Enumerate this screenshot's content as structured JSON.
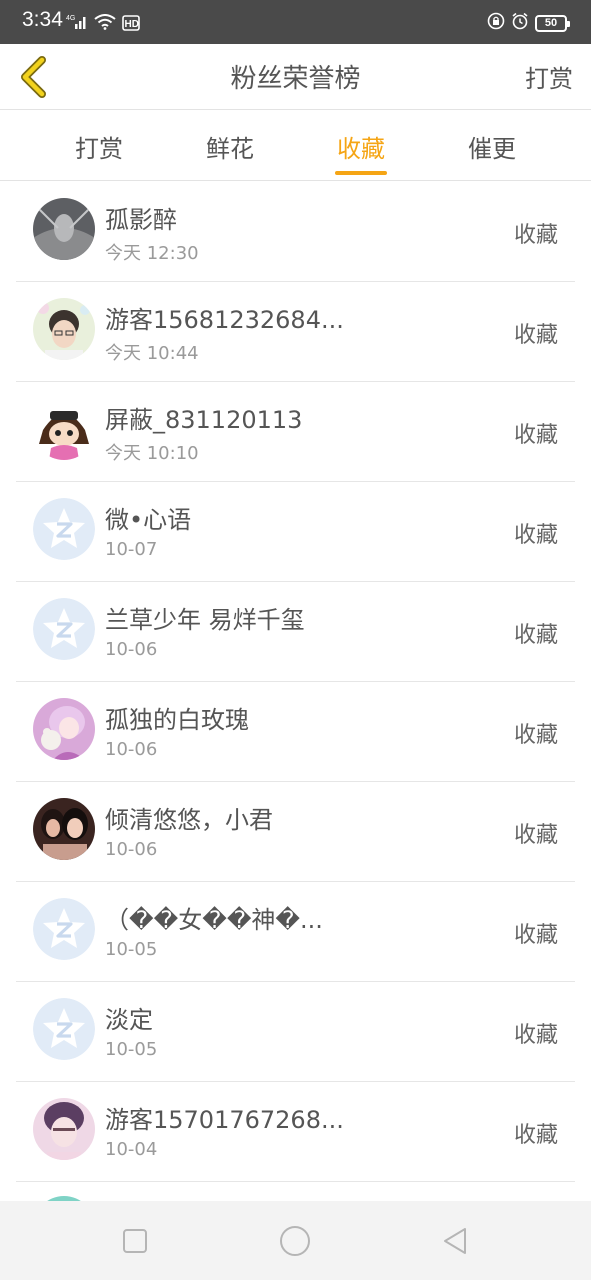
{
  "status_bar": {
    "time": "3:34",
    "network": "4G",
    "hd": "HD",
    "battery": "50"
  },
  "header": {
    "title": "粉丝荣誉榜",
    "action": "打赏",
    "back_icon": "chevron-left-icon"
  },
  "tabs": [
    {
      "label": "打赏"
    },
    {
      "label": "鲜花"
    },
    {
      "label": "收藏"
    },
    {
      "label": "催更"
    }
  ],
  "active_tab": "收藏",
  "colors": {
    "accent": "#f5a515",
    "status_bar": "#4a4a4a",
    "text": "#555555",
    "subtext": "#9a9a9a"
  },
  "fans": [
    {
      "name": "孤影醉",
      "time": "今天 12:30",
      "action": "收藏",
      "avatar": "photo-tunnel"
    },
    {
      "name": "游客15681232684...",
      "time": "今天 10:44",
      "action": "收藏",
      "avatar": "photo-girl-glasses"
    },
    {
      "name": "屏蔽_831120113",
      "time": "今天 10:10",
      "action": "收藏",
      "avatar": "cartoon-girl"
    },
    {
      "name": "微•心语",
      "time": "10-07",
      "action": "收藏",
      "avatar": "default-star"
    },
    {
      "name": "兰草少年 易烊千玺",
      "time": "10-06",
      "action": "收藏",
      "avatar": "default-star"
    },
    {
      "name": "孤独的白玫瑰",
      "time": "10-06",
      "action": "收藏",
      "avatar": "photo-doll-pink"
    },
    {
      "name": "倾清悠悠，小君",
      "time": "10-06",
      "action": "收藏",
      "avatar": "photo-two-girls"
    },
    {
      "name": "（��女��神�...",
      "time": "10-05",
      "action": "收藏",
      "avatar": "default-star"
    },
    {
      "name": "淡定",
      "time": "10-05",
      "action": "收藏",
      "avatar": "default-star"
    },
    {
      "name": "游客15701767268...",
      "time": "10-04",
      "action": "收藏",
      "avatar": "photo-girl-pink"
    }
  ],
  "nav": {
    "recent": "square-icon",
    "home": "circle-icon",
    "back": "triangle-back-icon"
  }
}
